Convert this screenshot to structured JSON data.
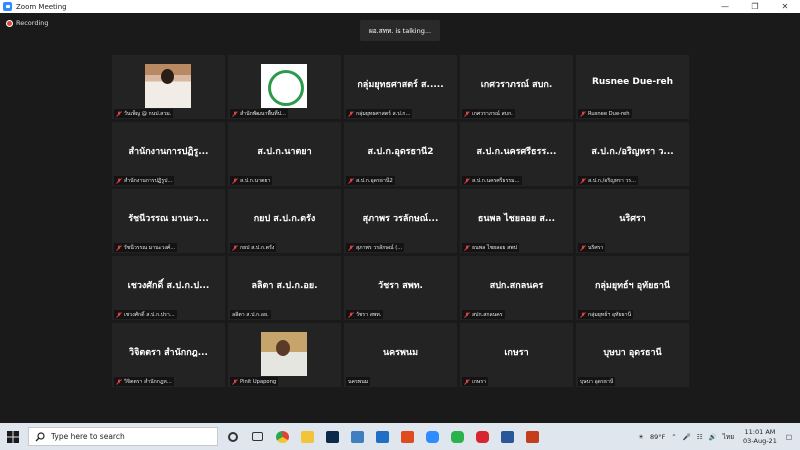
{
  "window": {
    "title": "Zoom Meeting"
  },
  "meeting": {
    "recording_label": "Recording",
    "talking_label": "ผอ.สทท. is talking..."
  },
  "tiles": [
    {
      "big": "",
      "name": "วันเพ็ญ @ กนป.สวม.",
      "photo": "woman"
    },
    {
      "big": "",
      "name": "สำนักพัฒนาพื้นที่ป...",
      "photo": "logo"
    },
    {
      "big": "กลุ่มยุทธศาสตร์ ส.....",
      "name": "กลุ่มยุทธศาสตร์ ส.ป.ก...",
      "photo": ""
    },
    {
      "big": "เกศวราภรณ์ สบก.",
      "name": "เกศวราภรณ์ สบก.",
      "photo": ""
    },
    {
      "big": "Rusnee Due-reh",
      "name": "Rusnee Due-reh",
      "photo": ""
    },
    {
      "big": "สำนักงานการปฏิรู...",
      "name": "สำนักงานการปฏิรูป...",
      "photo": ""
    },
    {
      "big": "ส.ป.ก.นาตยา",
      "name": "ส.ป.ก.นาตยา",
      "photo": ""
    },
    {
      "big": "ส.ป.ก.อุดรธานี2",
      "name": "ส.ป.ก.อุดรธานี2",
      "photo": ""
    },
    {
      "big": "ส.ป.ก.นครศรีธรร...",
      "name": "ส.ป.ก.นครศรีธรรม...",
      "photo": ""
    },
    {
      "big": "ส.ป.ก./อริญหรา ว...",
      "name": "ส.ป.ก./อริญหรา วร...",
      "photo": ""
    },
    {
      "big": "รัชนีวรรณ มานะว...",
      "name": "รัชนีวรรณ มานะวงศ์...",
      "photo": ""
    },
    {
      "big": "กยป ส.ป.ก.ตรัง",
      "name": "กยป ส.ป.ก.ตรัง",
      "photo": ""
    },
    {
      "big": "สุภาพร วรลักษณ์...",
      "name": "สุภาพร วรลักษณ์ (...",
      "photo": ""
    },
    {
      "big": "ธนพล ไชยลอย ส...",
      "name": "ธนพล ไชยลอย สพป",
      "photo": ""
    },
    {
      "big": "นริศรา",
      "name": "นริศรา",
      "photo": ""
    },
    {
      "big": "เชวงศักดิ์ ส.ป.ก.ป...",
      "name": "เชวงศักดิ์ ส.ป.ก.ปรา...",
      "photo": ""
    },
    {
      "big": "ลลิตา ส.ป.ก.อย.",
      "name": "ลลิตา ส.ป.ก.อย.",
      "photo": "",
      "muted": false
    },
    {
      "big": "วัชรา สพท.",
      "name": "วัชรา สพท.",
      "photo": ""
    },
    {
      "big": "สปก.สกลนคร",
      "name": "สปก.สกลนคร",
      "photo": ""
    },
    {
      "big": "กลุ่มยุทธ์ฯ อุทัยธานี",
      "name": "กลุ่มยุทธ์ฯ อุทัยธานี",
      "photo": ""
    },
    {
      "big": "วิจิตตรา สำนักกฎ...",
      "name": "วิจิตตรา สำนักกฎห...",
      "photo": ""
    },
    {
      "big": "",
      "name": "Pinit Upapong",
      "photo": "man"
    },
    {
      "big": "นครพนม",
      "name": "นครพนม",
      "photo": "",
      "muted": false
    },
    {
      "big": "เกษรา",
      "name": "เกษรา",
      "photo": ""
    },
    {
      "big": "บุษบา อุดรธานี",
      "name": "บุษบา อุดรธานี",
      "photo": "",
      "muted": false
    }
  ],
  "taskbar": {
    "search_placeholder": "Type here to search",
    "apps": [
      {
        "icon": "task-view-icon",
        "color": "#333333"
      },
      {
        "icon": "multitask-icon",
        "color": "#333333"
      },
      {
        "icon": "chrome-icon",
        "color": "#e34133"
      },
      {
        "icon": "file-explorer-icon",
        "color": "#f3c33a"
      },
      {
        "icon": "photoshop-icon",
        "color": "#0b2a4a"
      },
      {
        "icon": "vector-app-icon",
        "color": "#3f7fbf"
      },
      {
        "icon": "mail-icon",
        "color": "#1f6fc5"
      },
      {
        "icon": "office-icon",
        "color": "#e04a1f"
      },
      {
        "icon": "zoom-icon",
        "color": "#2d8cff"
      },
      {
        "icon": "line-icon",
        "color": "#2ab24b"
      },
      {
        "icon": "recorder-icon",
        "color": "#d8262e"
      },
      {
        "icon": "word-icon",
        "color": "#2b579a"
      },
      {
        "icon": "powerpoint-icon",
        "color": "#c43e1c"
      }
    ],
    "weather": "89°F",
    "language": "ไทย",
    "time": "11:01 AM",
    "date": "03-Aug-21"
  }
}
